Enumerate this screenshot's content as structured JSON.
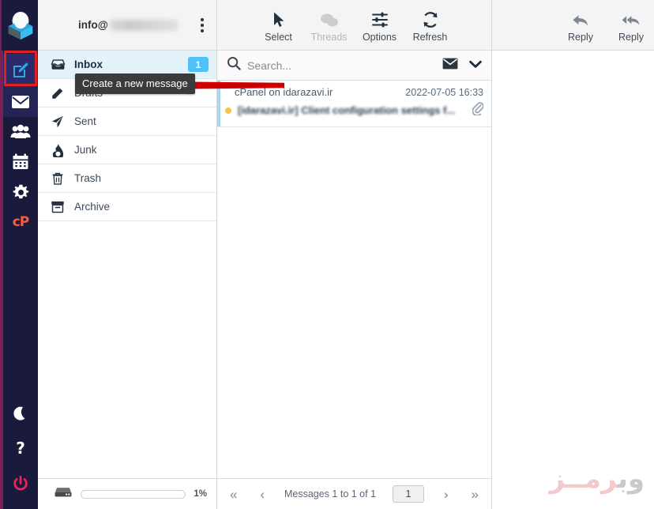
{
  "app": {
    "name": "Roundcube Webmail",
    "logo_icon": "roundcube-cube-logo"
  },
  "task_sidebar": {
    "items": [
      {
        "name": "compose",
        "icon": "compose-pencil-icon",
        "label": "Compose",
        "active": true
      },
      {
        "name": "mail",
        "icon": "envelope-icon",
        "label": "Mail",
        "active": false
      },
      {
        "name": "contacts",
        "icon": "people-icon",
        "label": "Contacts",
        "active": false
      },
      {
        "name": "calendar",
        "icon": "calendar-icon",
        "label": "Calendar",
        "active": false
      },
      {
        "name": "settings",
        "icon": "gear-icon",
        "label": "Settings",
        "active": false
      },
      {
        "name": "cpanel",
        "icon": "cpanel-logo-icon",
        "label": "cP",
        "active": false
      }
    ],
    "bottom_items": [
      {
        "name": "dark-mode",
        "icon": "moon-icon",
        "label": "Dark mode"
      },
      {
        "name": "help",
        "icon": "question-mark-icon",
        "label": "Help"
      },
      {
        "name": "logout",
        "icon": "power-icon",
        "label": "Logout"
      }
    ]
  },
  "folders_panel": {
    "account_prefix": "info@",
    "account_domain_blurred": "",
    "options_icon": "kebab-menu-icon",
    "items": [
      {
        "label": "Inbox",
        "icon": "inbox-icon",
        "badge": "1",
        "selected": true
      },
      {
        "label": "Drafts",
        "icon": "drafts-icon",
        "badge": "",
        "selected": false
      },
      {
        "label": "Sent",
        "icon": "sent-paper-plane-icon",
        "badge": "",
        "selected": false
      },
      {
        "label": "Junk",
        "icon": "junk-fire-icon",
        "badge": "",
        "selected": false
      },
      {
        "label": "Trash",
        "icon": "trash-icon",
        "badge": "",
        "selected": false
      },
      {
        "label": "Archive",
        "icon": "archive-box-icon",
        "badge": "",
        "selected": false
      }
    ],
    "quota": {
      "icon": "disk-drive-icon",
      "percent_label": "1%",
      "percent_value": 1
    }
  },
  "list_toolbar": {
    "buttons": [
      {
        "label": "Select",
        "icon": "cursor-arrow-icon",
        "disabled": false
      },
      {
        "label": "Threads",
        "icon": "threads-bubbles-icon",
        "disabled": true
      },
      {
        "label": "Options",
        "icon": "sliders-options-icon",
        "disabled": false
      },
      {
        "label": "Refresh",
        "icon": "refresh-circular-arrows-icon",
        "disabled": false
      }
    ]
  },
  "search": {
    "icon": "search-magnifier-icon",
    "placeholder": "Search...",
    "value": "",
    "scope_icon": "envelope-icon",
    "dropdown_icon": "chevron-down-icon"
  },
  "message_list": {
    "messages": [
      {
        "from": "cPanel on idarazavi.ir",
        "date": "2022-07-05 16:33",
        "subject": "[idarazavi.ir] Client configuration settings f...",
        "unread": true,
        "has_attachment": true,
        "attachment_icon": "paperclip-icon"
      }
    ],
    "footer": {
      "first_icon": "double-chevron-left-icon",
      "prev_icon": "chevron-left-icon",
      "info": "Messages 1 to 1 of 1",
      "page_number": "1",
      "next_icon": "chevron-right-icon",
      "last_icon": "double-chevron-right-icon"
    }
  },
  "preview_toolbar": {
    "buttons": [
      {
        "label": "Reply",
        "icon": "reply-arrow-icon"
      },
      {
        "label": "Reply",
        "icon": "reply-all-arrow-icon"
      }
    ]
  },
  "watermark": {
    "text_gray": "وب",
    "text_pink": "رمــز"
  },
  "annotations": {
    "tooltip_text": "Create a new message",
    "highlight_color": "#e02020",
    "arrow_color": "#cc0000"
  }
}
